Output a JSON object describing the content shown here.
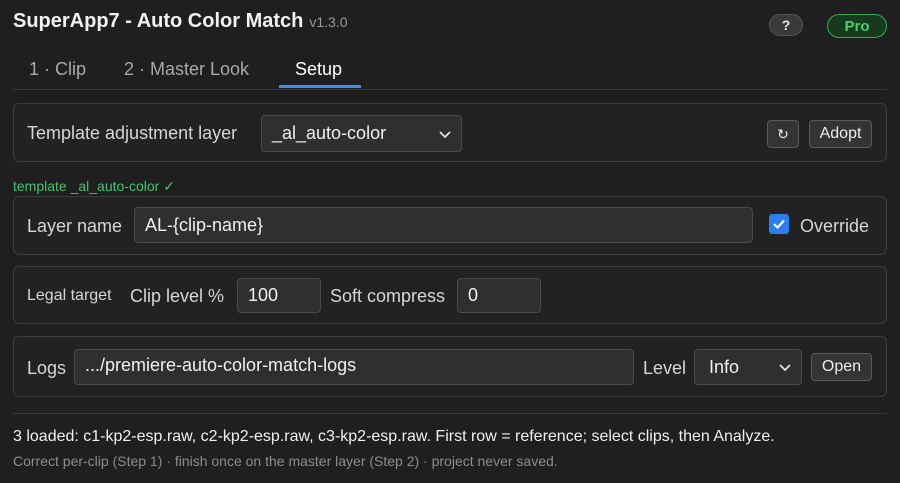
{
  "app": {
    "title": "SuperApp7 - Auto Color Match",
    "version": "v1.3.0",
    "help_label": "?",
    "pro_label": "Pro"
  },
  "tabs": [
    {
      "label": "1 · Clip",
      "active": false
    },
    {
      "label": "2 · Master Look",
      "active": false
    },
    {
      "label": "Setup",
      "active": true
    }
  ],
  "template_panel": {
    "label": "Template adjustment layer",
    "selected": "_al_auto-color",
    "refresh_label": "↻",
    "adopt_label": "Adopt"
  },
  "template_status": "template _al_auto-color ✓",
  "layer_panel": {
    "label": "Layer name",
    "value": "AL-{clip-name}",
    "override_label": "Override",
    "override_checked": true
  },
  "legal_panel": {
    "label": "Legal target",
    "clip_label": "Clip level %",
    "clip_value": "100",
    "soft_label": "Soft compress",
    "soft_value": "0"
  },
  "logs_panel": {
    "label": "Logs",
    "path": ".../premiere-auto-color-match-logs",
    "level_label": "Level",
    "level_value": "Info",
    "open_label": "Open"
  },
  "footer": {
    "status": "3 loaded: c1-kp2-esp.raw, c2-kp2-esp.raw, c3-kp2-esp.raw. First row = reference; select clips, then Analyze.",
    "hint": "Correct per-clip (Step 1) · finish once on the master layer (Step 2) · project never saved."
  },
  "colors": {
    "accent": "#3f8ef5",
    "success": "#4cc26a",
    "pro_border": "#34a853",
    "background": "#1f1f1f"
  }
}
